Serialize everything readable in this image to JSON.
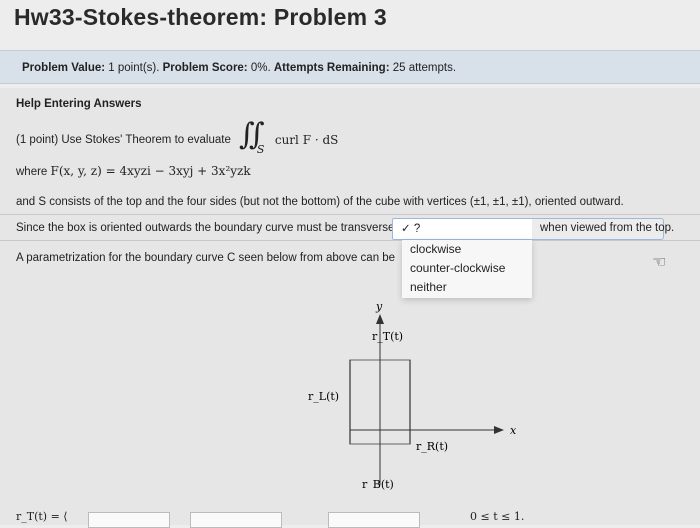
{
  "header": {
    "title": "Hw33-Stokes-theorem: Problem 3"
  },
  "value_bar": {
    "value_label": "Problem Value:",
    "value": "1 point(s).",
    "score_label": "Problem Score:",
    "score": "0%.",
    "attempts_label": "Attempts Remaining:",
    "attempts": "25 attempts."
  },
  "help": {
    "label": "Help Entering Answers"
  },
  "problem": {
    "prompt": "(1 point) Use Stokes' Theorem to evaluate",
    "integral_sub": "S",
    "integrand": "curl F · dS",
    "where_label": "where",
    "field": "F(x, y, z) = 4xyzi − 3xyj + 3x²yzk",
    "and_line": "and S consists of the top and the four sides (but not the bottom) of the cube with vertices (±1, ±1, ±1), oriented outward.",
    "since_line": "Since the box is oriented outwards the boundary curve must be transverse",
    "when_line": "when viewed from the top.",
    "param_line": "A parametrization for the boundary curve C seen below from above can be"
  },
  "select": {
    "selected": "✓ ?",
    "options": [
      "clockwise",
      "counter-clockwise",
      "neither"
    ]
  },
  "diagram": {
    "y_axis": "y",
    "x_axis": "x",
    "top_label": "r_T(t)",
    "left_label": "r_L(t)",
    "right_label": "r_R(t)",
    "bottom_label": "r_B(t)"
  },
  "bottom": {
    "r_label": "r_T(t) = ⟨",
    "range": "0 ≤ t ≤ 1."
  }
}
